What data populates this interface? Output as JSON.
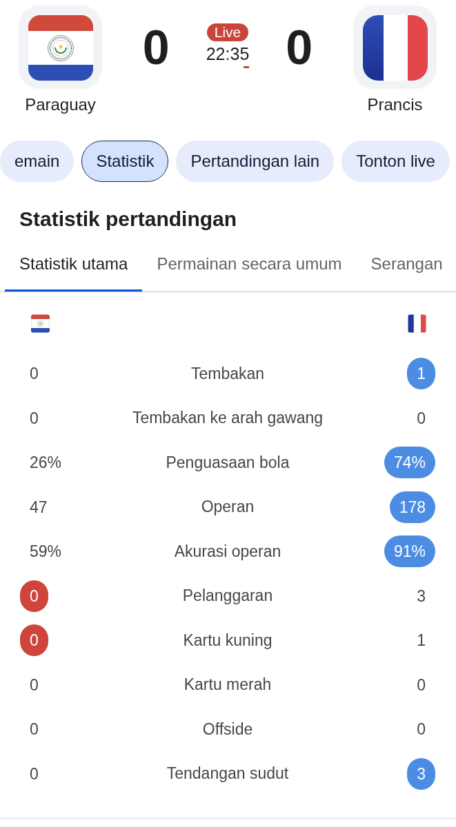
{
  "match": {
    "teams": [
      {
        "name": "Paraguay",
        "score": "0",
        "color": "#cf453c"
      },
      {
        "name": "Prancis",
        "score": "0",
        "color": "#4c8ce3"
      }
    ],
    "status": {
      "badge": "Live",
      "clock": "22:35"
    }
  },
  "chips": [
    {
      "label": "emain",
      "selected": false
    },
    {
      "label": "Statistik",
      "selected": true
    },
    {
      "label": "Pertandingan lain",
      "selected": false
    },
    {
      "label": "Tonton live",
      "selected": false
    }
  ],
  "stats_section": {
    "title": "Statistik pertandingan",
    "tabs": [
      {
        "label": "Statistik utama",
        "selected": true
      },
      {
        "label": "Permainan secara umum",
        "selected": false
      },
      {
        "label": "Serangan",
        "selected": false
      }
    ],
    "rows": [
      {
        "label": "Tembakan",
        "home": {
          "value": "0",
          "leading": false
        },
        "away": {
          "value": "1",
          "leading": true
        }
      },
      {
        "label": "Tembakan ke arah gawang",
        "home": {
          "value": "0",
          "leading": false
        },
        "away": {
          "value": "0",
          "leading": false
        }
      },
      {
        "label": "Penguasaan bola",
        "home": {
          "value": "26%",
          "leading": false
        },
        "away": {
          "value": "74%",
          "leading": true
        }
      },
      {
        "label": "Operan",
        "home": {
          "value": "47",
          "leading": false
        },
        "away": {
          "value": "178",
          "leading": true
        }
      },
      {
        "label": "Akurasi operan",
        "home": {
          "value": "59%",
          "leading": false
        },
        "away": {
          "value": "91%",
          "leading": true
        }
      },
      {
        "label": "Pelanggaran",
        "home": {
          "value": "0",
          "leading": true
        },
        "away": {
          "value": "3",
          "leading": false
        }
      },
      {
        "label": "Kartu kuning",
        "home": {
          "value": "0",
          "leading": true
        },
        "away": {
          "value": "1",
          "leading": false
        }
      },
      {
        "label": "Kartu merah",
        "home": {
          "value": "0",
          "leading": false
        },
        "away": {
          "value": "0",
          "leading": false
        }
      },
      {
        "label": "Offside",
        "home": {
          "value": "0",
          "leading": false
        },
        "away": {
          "value": "0",
          "leading": false
        }
      },
      {
        "label": "Tendangan sudut",
        "home": {
          "value": "0",
          "leading": false
        },
        "away": {
          "value": "3",
          "leading": true
        }
      }
    ]
  }
}
